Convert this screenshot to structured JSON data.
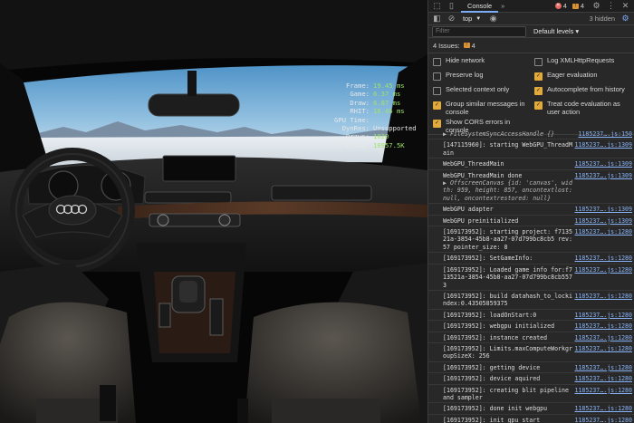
{
  "scene": {
    "stats": [
      {
        "label": "Frame:",
        "value": "19.45 ms"
      },
      {
        "label": "Game:",
        "value": "6.37 ms"
      },
      {
        "label": "Draw:",
        "value": "6.87 ms"
      },
      {
        "label": "RHIT:",
        "value": "18.46 ms"
      },
      {
        "label": "GPU Time:",
        "value": ""
      },
      {
        "label": "DynRes:",
        "value": "Unsupported"
      },
      {
        "label": "Draws:",
        "value": "1020"
      },
      {
        "label": "Prims:",
        "value": "10957.5K"
      }
    ]
  },
  "devtools": {
    "tabs": {
      "console": "Console",
      "more": "»"
    },
    "errors_count": "4",
    "warnings_count": "4",
    "context": "top",
    "hidden": "3 hidden",
    "filter_placeholder": "Filter",
    "levels": "Default levels ▾",
    "issues_label": "4 Issues:",
    "issues_count": "4",
    "settings_left": [
      {
        "label": "Hide network",
        "checked": false
      },
      {
        "label": "Preserve log",
        "checked": false
      },
      {
        "label": "Selected context only",
        "checked": false
      },
      {
        "label": "Group similar messages in console",
        "checked": true
      },
      {
        "label": "Show CORS errors in console",
        "checked": true
      }
    ],
    "settings_right": [
      {
        "label": "Log XMLHttpRequests",
        "checked": false
      },
      {
        "label": "Eager evaluation",
        "checked": true
      },
      {
        "label": "Autocomplete from history",
        "checked": true
      },
      {
        "label": "Treat code evaluation as user action",
        "checked": true
      }
    ],
    "logs": [
      {
        "text": "▶ FileSystemSyncAccessHandle {}",
        "link": "1185237….js:150",
        "style": "obj"
      },
      {
        "text": "[147115960]: starting WebGPU_ThreadMain",
        "link": "1185237….js:1309"
      },
      {
        "text": "WebGPU_ThreadMain",
        "link": "1185237….js:1309"
      },
      {
        "text": "WebGPU_ThreadMain done",
        "link": "1185237….js:1309",
        "extra": "▶ OffscreenCanvas {id: 'canvas', width: 959, height: 857, oncontextlost: null, oncontextrestored: null}"
      },
      {
        "text": "WebGPU adapter",
        "link": "1185237….js:1309"
      },
      {
        "text": "WebGPU preinitialized",
        "link": "1185237….js:1309"
      },
      {
        "text": "[169173952]: starting project: f713521a-3854-45b8-aa27-07d799bc8cb5 rev: 57 pointer_size: 8",
        "link": "1185237….js:1280"
      },
      {
        "text": "[169173952]: SetGameInfo:",
        "link": "1185237….js:1280"
      },
      {
        "text": "[169173952]: Loaded game info for:f713521a-3854-45b8-aa27-07d799bc8cb5573",
        "link": "1185237….js:1280"
      },
      {
        "text": "[169173952]: build datahash_to_lockindex:0.43505859375",
        "link": "1185237….js:1280"
      },
      {
        "text": "[169173952]: loadOnStart:0",
        "link": "1185237….js:1280"
      },
      {
        "text": "[169173952]: webgpu initialized",
        "link": "1185237….js:1280"
      },
      {
        "text": "[169173952]: instance created",
        "link": "1185237….js:1280"
      },
      {
        "text": "[169173952]: Limits.maxComputeWorkgroupSizeX: 256",
        "link": "1185237….js:1280"
      },
      {
        "text": "[169173952]: getting device",
        "link": "1185237….js:1280"
      },
      {
        "text": "[169173952]: device aquired",
        "link": "1185237….js:1280"
      },
      {
        "text": "[169173952]: creating blit pipeline and sampler",
        "link": "1185237….js:1280"
      },
      {
        "text": "[169173952]: done init webgpu",
        "link": "1185237….js:1280"
      },
      {
        "text": "[169173952]: init gpu start",
        "link": "1185237….js:1280"
      }
    ]
  }
}
